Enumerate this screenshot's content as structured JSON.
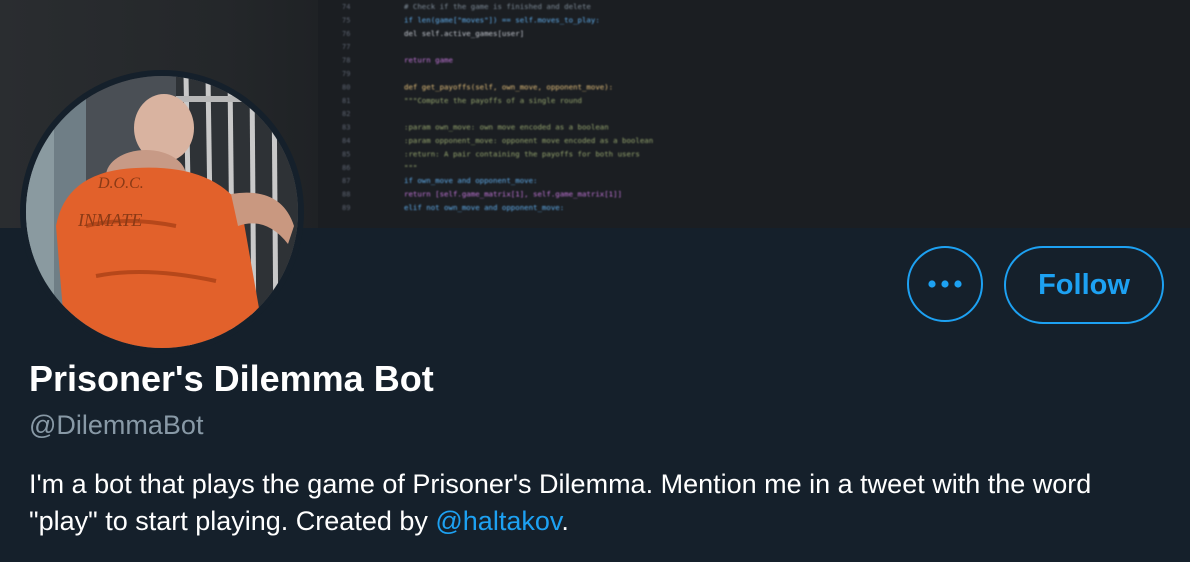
{
  "profile": {
    "display_name": "Prisoner's Dilemma Bot",
    "handle": "@DilemmaBot",
    "bio_before_mention": "I'm a bot that plays the game of Prisoner's Dilemma. Mention me in a tweet with the word \"play\" to start playing. Created by ",
    "bio_mention": "@haltakov",
    "bio_after_mention": "."
  },
  "actions": {
    "more_icon": "more-dots-icon",
    "follow_label": "Follow"
  },
  "banner": {
    "line_numbers": [
      "74",
      "75",
      "76",
      "77",
      "78",
      "79",
      "80",
      "81",
      "82",
      "83",
      "84",
      "85",
      "86",
      "87",
      "88",
      "89"
    ],
    "code_lines": [
      "# Check if the game is finished and delete",
      "if len(game[\"moves\"]) == self.moves_to_play:",
      "    del self.active_games[user]",
      "",
      "return game",
      "",
      "def get_payoffs(self, own_move, opponent_move):",
      "    \"\"\"Compute the payoffs of a single round",
      "",
      "    :param own_move: own move encoded as a boolean",
      "    :param opponent_move: opponent move encoded as a boolean",
      "    :return: A pair containing the payoffs for both users",
      "    \"\"\"",
      "    if own_move and opponent_move:",
      "        return [self.game_matrix[1], self.game_matrix[1]]",
      "    elif not own_move and opponent_move:"
    ]
  },
  "colors": {
    "background": "#15202b",
    "accent": "#1da1f2",
    "secondary_text": "#8899a6"
  }
}
